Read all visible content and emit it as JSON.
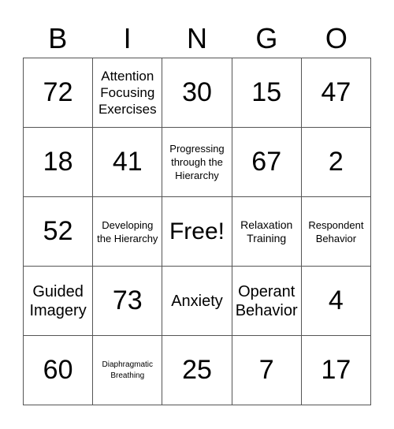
{
  "header": [
    "B",
    "I",
    "N",
    "G",
    "O"
  ],
  "cells": [
    [
      "72",
      "Attention Focusing Exercises",
      "30",
      "15",
      "47"
    ],
    [
      "18",
      "41",
      "Progressing through the Hierarchy",
      "67",
      "2"
    ],
    [
      "52",
      "Developing the Hierarchy",
      "Free!",
      "Relaxation Training",
      "Respondent Behavior"
    ],
    [
      "Guided Imagery",
      "73",
      "Anxiety",
      "Operant Behavior",
      "4"
    ],
    [
      "60",
      "Diaphragmatic Breathing",
      "25",
      "7",
      "17"
    ]
  ]
}
